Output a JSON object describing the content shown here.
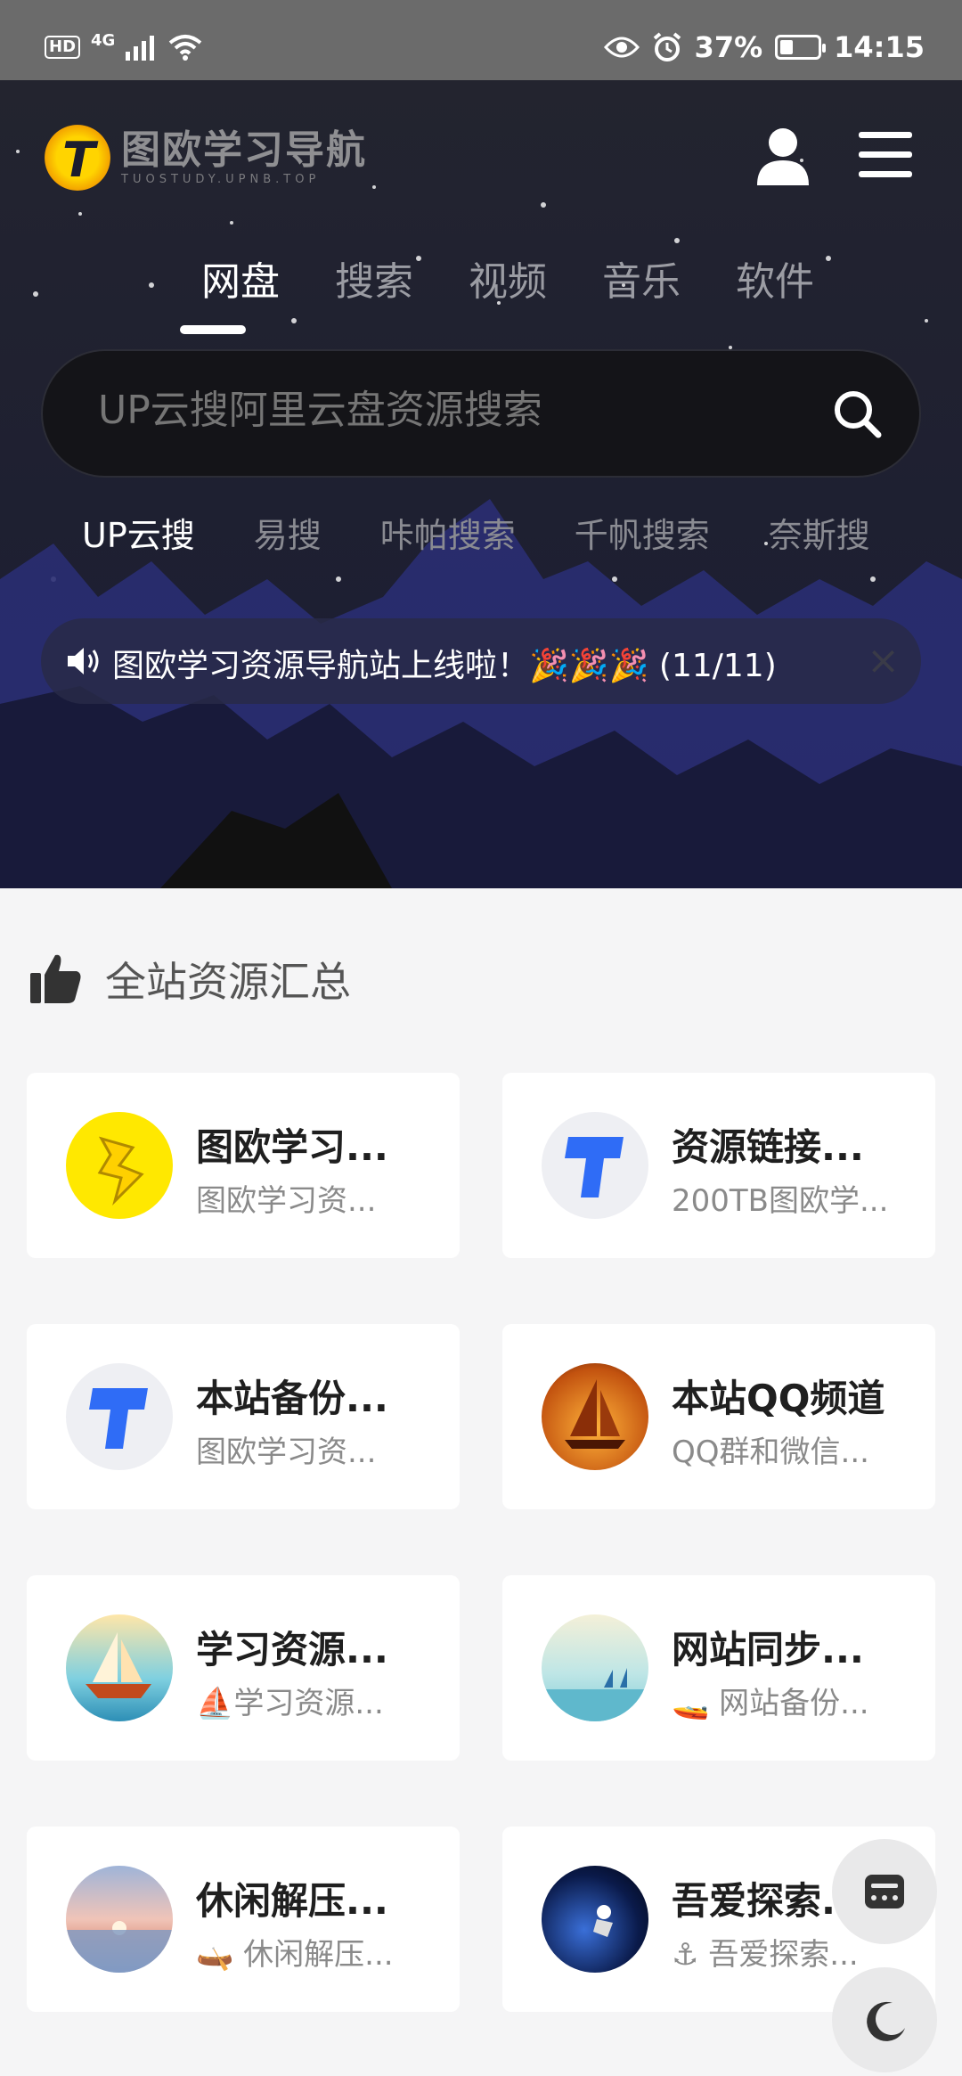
{
  "status_bar": {
    "hd": "HD",
    "network": "4G",
    "battery": "37%",
    "time": "14:15"
  },
  "header": {
    "logo_title": "图欧学习导航",
    "logo_subtitle": "TUOSTUDY.UPNB.TOP",
    "logo_letter": "T"
  },
  "tabs": [
    "网盘",
    "搜索",
    "视频",
    "音乐",
    "软件"
  ],
  "search": {
    "placeholder": "UP云搜阿里云盘资源搜索"
  },
  "engines": [
    "UP云搜",
    "易搜",
    "咔帕搜索",
    "千帆搜索",
    "奈斯搜"
  ],
  "notice": {
    "text": "图欧学习资源导航站上线啦！🎉🎉🎉 (11/11)",
    "close": "×"
  },
  "section": {
    "title": "全站资源汇总"
  },
  "cards": [
    {
      "title": "图欧学习...",
      "desc": "图欧学习资..."
    },
    {
      "title": "资源链接...",
      "desc": "200TB图欧学..."
    },
    {
      "title": "本站备份...",
      "desc": "图欧学习资..."
    },
    {
      "title": "本站QQ频道",
      "desc": "QQ群和微信..."
    },
    {
      "title": "学习资源...",
      "desc": "⛵学习资源..."
    },
    {
      "title": "网站同步...",
      "desc": "🚤 网站备份..."
    },
    {
      "title": "休闲解压...",
      "desc": "🛶 休闲解压..."
    },
    {
      "title": "吾爱探索...",
      "desc": "⚓ 吾爱探索..."
    }
  ],
  "colors": {
    "hero_bg": "#1b1d2e",
    "mountains": "#2a2e73",
    "accent_yellow": "#ffd400"
  }
}
